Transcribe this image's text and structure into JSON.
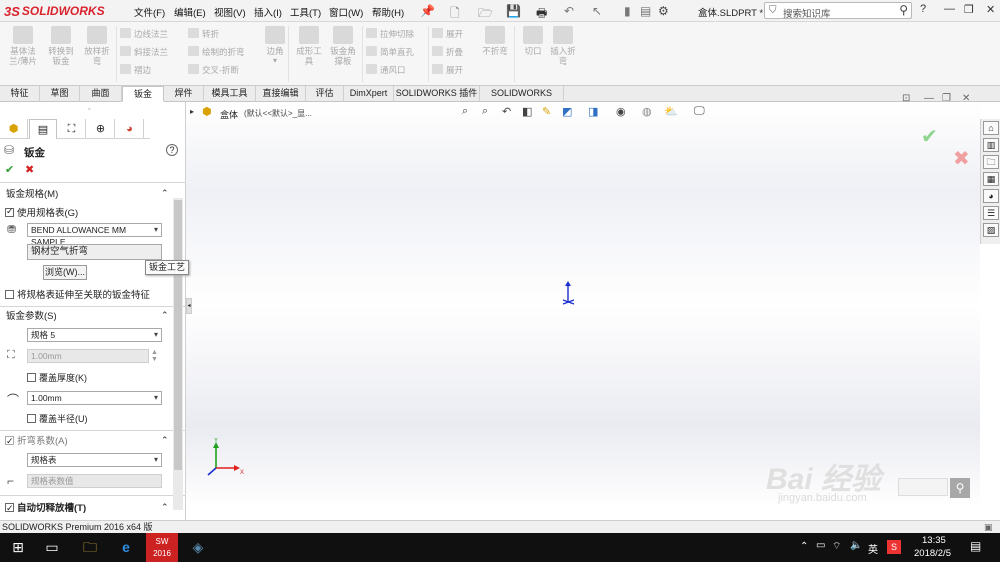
{
  "app": {
    "logo_ds": "3S",
    "logo_text": "SOLIDWORKS",
    "filename": "盒体.SLDPRT *"
  },
  "menu": [
    "文件(F)",
    "编辑(E)",
    "视图(V)",
    "插入(I)",
    "工具(T)",
    "窗口(W)",
    "帮助(H)"
  ],
  "search": {
    "placeholder": "搜索知识库"
  },
  "window_buttons": {
    "help": "?",
    "minimize": "—",
    "restore": "❐",
    "close": "✕"
  },
  "ribbon": {
    "big": [
      {
        "label": "基体法\n兰/薄片"
      },
      {
        "label": "转换到\n钣金"
      },
      {
        "label": "放样折\n弯"
      },
      {
        "label": "边角"
      },
      {
        "label": "成形工\n具"
      },
      {
        "label": "钣金角\n撑板"
      },
      {
        "label": "不折弯"
      },
      {
        "label": "切口"
      },
      {
        "label": "插入折\n弯"
      }
    ],
    "small_col1": [
      "边线法兰",
      "斜接法兰",
      "褶边"
    ],
    "small_col2": [
      "转折",
      "绘制的折弯",
      "交叉-折断"
    ],
    "small_col3": [
      "拉伸切除",
      "简单直孔",
      "通风口"
    ],
    "small_col4": [
      "展开",
      "折叠",
      "展开"
    ]
  },
  "tabs": [
    "特征",
    "草图",
    "曲面",
    "钣金",
    "焊件",
    "模具工具",
    "直接编辑",
    "评估",
    "DimXpert",
    "SOLIDWORKS 插件",
    "SOLIDWORKS MBD"
  ],
  "active_tab": "钣金",
  "tree": {
    "root": "盒体",
    "config": "(默认<<默认>_显..."
  },
  "panel": {
    "title": "钣金",
    "ok": "✔",
    "cancel": "✖",
    "help": "?",
    "sec_gauge": "钣金规格(M)",
    "use_gauge_table": "使用规格表(G)",
    "gauge_table_value": "BEND ALLOWANCE MM SAMPLE",
    "bend_process": "钢材空气折弯",
    "browse": "浏览(W)...",
    "tooltip": "钣金工艺",
    "extend_gauge": "将规格表延伸至关联的钣金特征",
    "sec_params": "钣金参数(S)",
    "gauge_value": "规格 5",
    "thickness": "1.00mm",
    "override_thickness": "覆盖厚度(K)",
    "radius": "1.00mm",
    "override_radius": "覆盖半径(U)",
    "sec_bend": "折弯系数(A)",
    "bend_type": "规格表",
    "bend_table_value": "规格表数值",
    "sec_relief": "自动切释放槽(T)"
  },
  "status": {
    "text": "SOLIDWORKS Premium 2016 x64 版"
  },
  "taskbar": {
    "ime": "英",
    "time": "13:35",
    "date": "2018/2/5",
    "sw_label": "SW 2016"
  },
  "axes": {
    "x": "X",
    "y": "Y"
  },
  "watermark": {
    "text": "Bai 经验",
    "sub": "jingyan.baidu.com"
  },
  "colors": {
    "accent": "#d9232d",
    "ok": "#2e9b2e",
    "cancel": "#d62020",
    "triad_x": "#e02020",
    "triad_y": "#20a020",
    "triad_z": "#1a2fd0"
  }
}
